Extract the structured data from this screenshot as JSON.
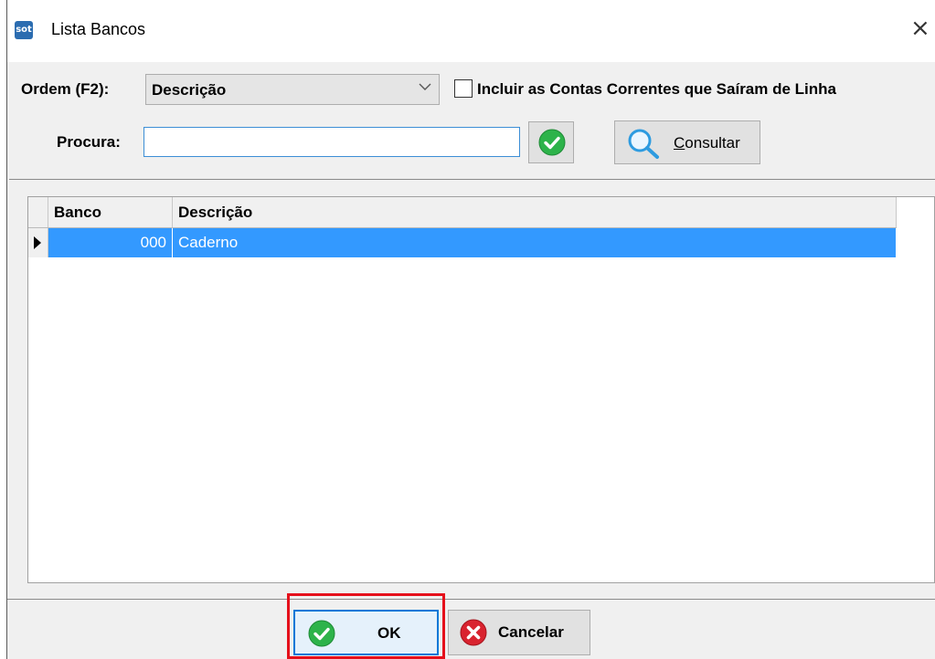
{
  "window": {
    "title": "Lista Bancos",
    "app_icon_text": "sot",
    "close_glyph": "×"
  },
  "toolbar": {
    "order_label": "Ordem (F2):",
    "order_selected": "Descrição",
    "include_label": "Incluir as Contas Correntes que Saíram de Linha",
    "include_checked": false,
    "search_label": "Procura:",
    "search_value": "",
    "consult_button": {
      "mnemonic": "C",
      "rest": "onsultar"
    }
  },
  "grid": {
    "columns": [
      "Banco",
      "Descrição"
    ],
    "rows": [
      {
        "banco": "000",
        "descricao": "Caderno",
        "selected": true
      }
    ]
  },
  "footer": {
    "ok_label": "OK",
    "cancel_label": "Cancelar"
  },
  "colors": {
    "selection": "#3399ff",
    "ok_green": "#2db34a",
    "cancel_red": "#d9232f",
    "highlight": "#e5101b",
    "focus_blue": "#0078d7"
  },
  "icons": {
    "app": "sot-app-icon",
    "confirm": "green-check-icon",
    "consult": "magnifier-icon",
    "cancel": "red-x-icon",
    "close": "close-icon"
  }
}
